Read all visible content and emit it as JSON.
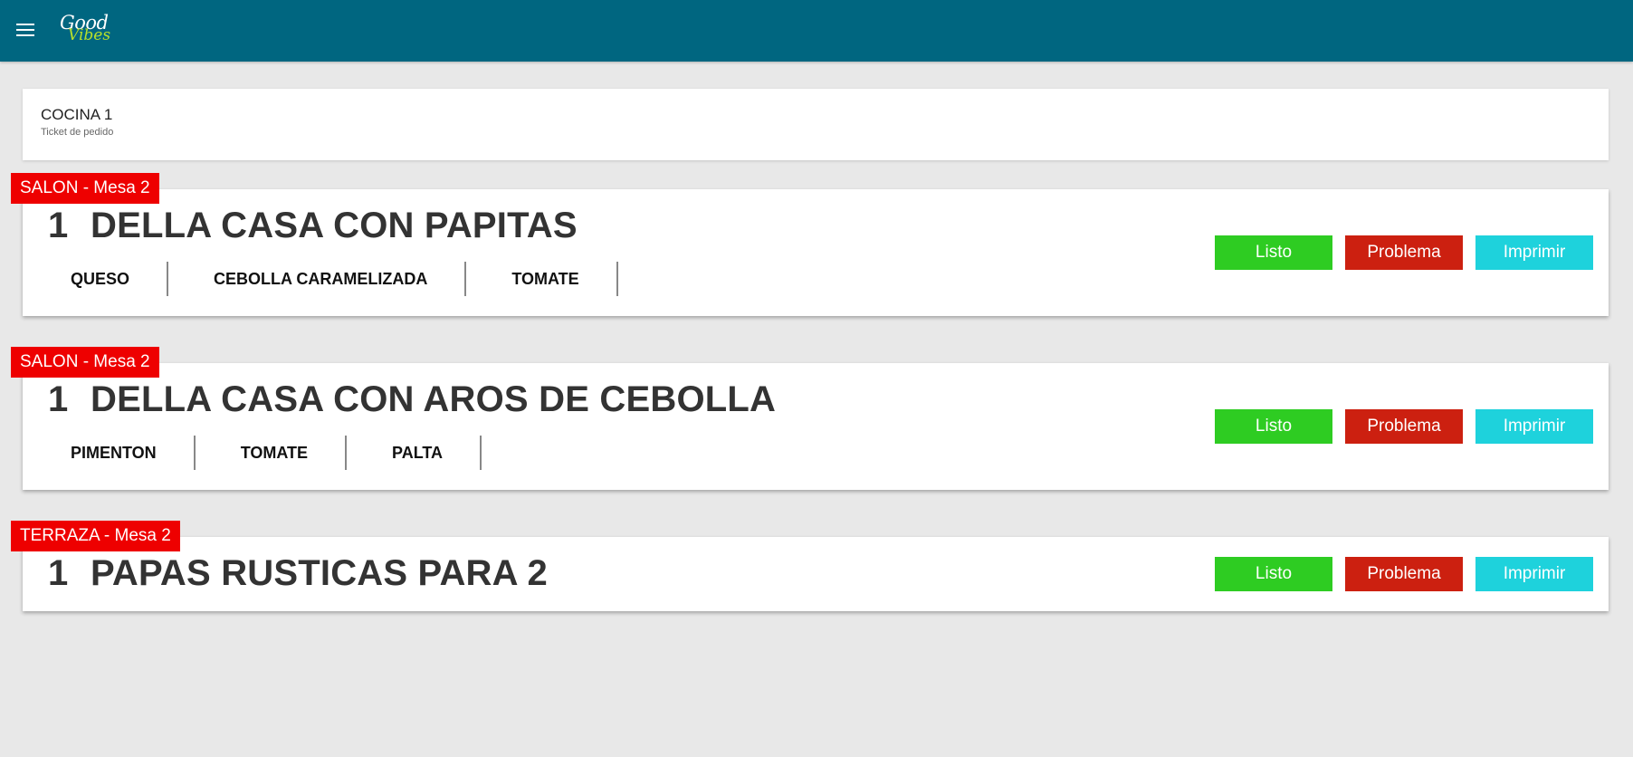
{
  "app": {
    "logo_top": "Good",
    "logo_bottom": "Vibes",
    "colors": {
      "topbar": "#006680",
      "tag": "#ee0000",
      "listo": "#2ecc22",
      "problema": "#cc2010",
      "imprimir": "#1ed2dc"
    }
  },
  "station": {
    "title": "COCINA 1",
    "subtitle": "Ticket de pedido"
  },
  "buttons": {
    "listo": "Listo",
    "problema": "Problema",
    "imprimir": "Imprimir"
  },
  "orders": [
    {
      "tag": "SALON - Mesa 2",
      "qty": "1",
      "item": "DELLA CASA CON PAPITAS",
      "modifiers": [
        "QUESO",
        "CEBOLLA CARAMELIZADA",
        "TOMATE"
      ]
    },
    {
      "tag": "SALON - Mesa 2",
      "qty": "1",
      "item": "DELLA CASA CON AROS DE CEBOLLA",
      "modifiers": [
        "PIMENTON",
        "TOMATE",
        "PALTA"
      ]
    },
    {
      "tag": "TERRAZA - Mesa 2",
      "qty": "1",
      "item": "PAPAS RUSTICAS PARA 2",
      "modifiers": []
    }
  ]
}
